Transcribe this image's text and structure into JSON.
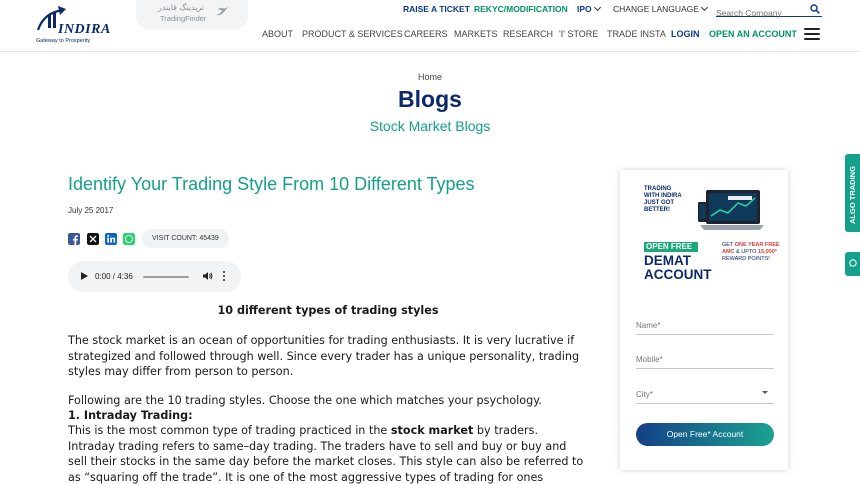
{
  "header": {
    "logo_text": "INDIRA",
    "logo_tagline": "Gateway to Prosperity",
    "badge_fa": "تریدینگ فایندر",
    "badge_en": "TradingFinder",
    "top_links": {
      "raise_ticket": "RAISE A TICKET",
      "rekyc": "REKYC/MODIFICATION",
      "ipo": "IPO",
      "change_language": "CHANGE LANGUAGE"
    },
    "search_placeholder": "Search Company",
    "nav": {
      "about": "ABOUT",
      "products": "PRODUCT & SERVICES",
      "careers": "CAREERS",
      "markets": "MARKETS",
      "research": "RESEARCH",
      "istore": "'I' STORE",
      "trade_insta": "TRADE INSTA",
      "login": "LOGIN",
      "open_account": "OPEN AN ACCOUNT"
    }
  },
  "hero": {
    "breadcrumb": "Home",
    "title": "Blogs",
    "subtitle": "Stock Market Blogs"
  },
  "article": {
    "title": "Identify Your Trading Style From 10 Different Types",
    "date": "July 25 2017",
    "visit_count": "VISIT COUNT: 45439",
    "audio_time": "0:00 / 4:36",
    "audio_progress": 0,
    "heading": "10 different types of trading styles",
    "para1": "The stock market is an ocean of opportunities for trading enthusiasts. It is very lucrative if strategized and followed through well. Since every trader has a unique personality, trading styles may differ from person to person.",
    "para2": "Following are the 10 trading styles. Choose the one which matches your psychology.",
    "section1_title": " 1. Intraday Trading:",
    "section1_a": "This is the most common type of trading practiced in the ",
    "section1_bold": "stock market",
    "section1_b": " by traders. Intraday trading refers to same–day trading. The traders have to sell and buy or buy and sell their stocks in the same day before the market closes. This style can also be referred to as “squaring off the trade”. It is one of the most aggressive types of trading for ones seeking"
  },
  "sidebar": {
    "promo_line1": "TRADING",
    "promo_line2": "WITH INDIRA",
    "promo_line3": "JUST GOT",
    "promo_line4": "BETTER!",
    "promo_free": "OPEN FREE",
    "promo_demat": "DEMAT",
    "promo_account": "ACCOUNT",
    "offer_a": "GET ",
    "offer_b": "ONE YEAR FREE AMC",
    "offer_c": " & UPTO ",
    "offer_d": "15,000*",
    "offer_e": " REWARD POINTS!",
    "name_placeholder": "Name*",
    "mobile_placeholder": "Mobile*",
    "city_placeholder": "City*",
    "cta_label": "Open Free* Account"
  },
  "side_tabs": {
    "algo": "ALGO TRADING"
  },
  "colors": {
    "navy": "#0c2a6b",
    "teal": "#14a08a",
    "green": "#00926b"
  }
}
